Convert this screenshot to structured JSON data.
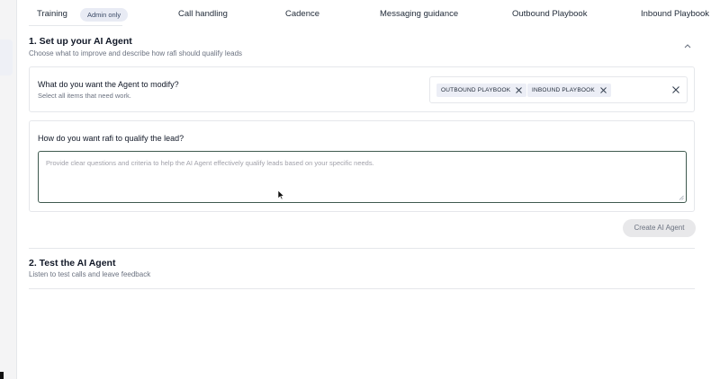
{
  "tabs": {
    "training": "Training",
    "admin_badge": "Admin only",
    "call_handling": "Call handling",
    "cadence": "Cadence",
    "messaging_guidance": "Messaging guidance",
    "outbound_playbook": "Outbound Playbook",
    "inbound_playbook": "Inbound Playbook"
  },
  "section1": {
    "title": "1. Set up your AI Agent",
    "subtitle": "Choose what to improve and describe how rafi should qualify leads",
    "chevron_icon": "chevron-up-icon",
    "modify_card": {
      "question": "What do you want the Agent to modify?",
      "helper": "Select all items that need work.",
      "chips": [
        "OUTBOUND PLAYBOOK",
        "INBOUND PLAYBOOK"
      ]
    },
    "qualify_card": {
      "question": "How do you want rafi to qualify the lead?",
      "placeholder": "Provide clear questions and criteria to help the AI Agent effectively qualify leads based on your specific needs."
    },
    "create_button": "Create AI Agent"
  },
  "section2": {
    "title": "2. Test the AI Agent",
    "subtitle": "Listen to test calls and leave feedback"
  },
  "colors": {
    "badge_bg": "#e8ebf4",
    "chip_bg": "#eceef6",
    "textarea_border": "#3f5a4f",
    "button_disabled_bg": "#e8e8ea"
  }
}
